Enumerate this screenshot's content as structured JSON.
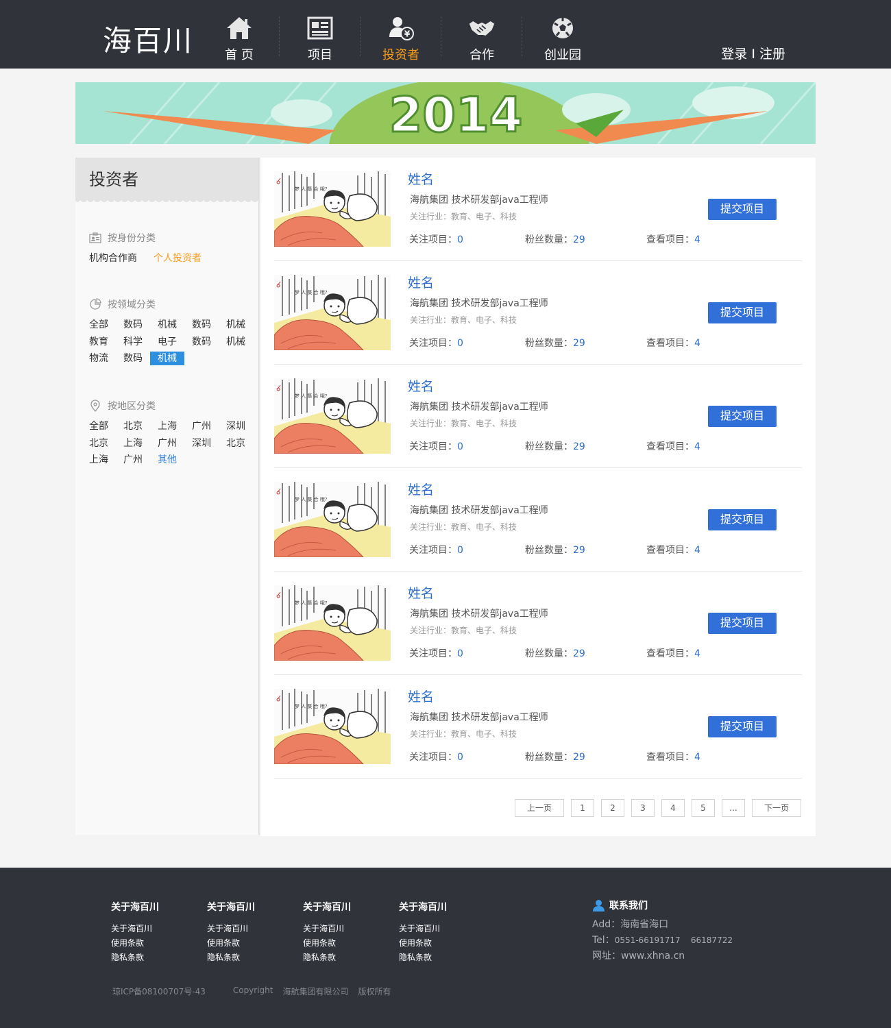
{
  "header": {
    "logo": "海百川",
    "nav": [
      {
        "label": "首 页",
        "icon": "home-icon"
      },
      {
        "label": "项目",
        "icon": "newspaper-icon"
      },
      {
        "label": "投资者",
        "icon": "investor-icon",
        "active": true
      },
      {
        "label": "合作",
        "icon": "handshake-icon"
      },
      {
        "label": "创业园",
        "icon": "football-icon"
      }
    ],
    "login": "登录",
    "divider": "I",
    "register": "注册"
  },
  "banner": {
    "text": "2014"
  },
  "sidebar": {
    "title": "投资者",
    "identity": {
      "heading": "按身份分类",
      "icon": "id-card-icon",
      "options": [
        "机构合作商",
        "个人投资者"
      ],
      "selected_index": 1
    },
    "field": {
      "heading": "按领域分类",
      "icon": "pie-chart-icon",
      "options": [
        "全部",
        "数码",
        "机械",
        "数码",
        "机械",
        "教育",
        "科学",
        "电子",
        "数码",
        "机械",
        "物流",
        "数码",
        "机械"
      ],
      "selected_index": 12
    },
    "region": {
      "heading": "按地区分类",
      "icon": "location-pin-icon",
      "options": [
        "全部",
        "北京",
        "上海",
        "广州",
        "深圳",
        "北京",
        "上海",
        "广州",
        "深圳",
        "北京",
        "上海",
        "广州",
        "其他"
      ],
      "selected_index": 12
    }
  },
  "investors": [
    {
      "name": "姓名",
      "org": "海航集团 技术研发部java工程师",
      "focus": "关注行业：教育、电子、科技",
      "follow_label": "关注项目：",
      "follow": "0",
      "fans_label": "粉丝数量：",
      "fans": "29",
      "view_label": "查看项目：",
      "views": "4",
      "button": "提交项目"
    },
    {
      "name": "姓名",
      "org": "海航集团 技术研发部java工程师",
      "focus": "关注行业：教育、电子、科技",
      "follow_label": "关注项目：",
      "follow": "0",
      "fans_label": "粉丝数量：",
      "fans": "29",
      "view_label": "查看项目：",
      "views": "4",
      "button": "提交项目"
    },
    {
      "name": "姓名",
      "org": "海航集团 技术研发部java工程师",
      "focus": "关注行业：教育、电子、科技",
      "follow_label": "关注项目：",
      "follow": "0",
      "fans_label": "粉丝数量：",
      "fans": "29",
      "view_label": "查看项目：",
      "views": "4",
      "button": "提交项目"
    },
    {
      "name": "姓名",
      "org": "海航集团 技术研发部java工程师",
      "focus": "关注行业：教育、电子、科技",
      "follow_label": "关注项目：",
      "follow": "0",
      "fans_label": "粉丝数量：",
      "fans": "29",
      "view_label": "查看项目：",
      "views": "4",
      "button": "提交项目"
    },
    {
      "name": "姓名",
      "org": "海航集团 技术研发部java工程师",
      "focus": "关注行业：教育、电子、科技",
      "follow_label": "关注项目：",
      "follow": "0",
      "fans_label": "粉丝数量：",
      "fans": "29",
      "view_label": "查看项目：",
      "views": "4",
      "button": "提交项目"
    },
    {
      "name": "姓名",
      "org": "海航集团 技术研发部java工程师",
      "focus": "关注行业：教育、电子、科技",
      "follow_label": "关注项目：",
      "follow": "0",
      "fans_label": "粉丝数量：",
      "fans": "29",
      "view_label": "查看项目：",
      "views": "4",
      "button": "提交项目"
    }
  ],
  "pagination": {
    "prev": "上一页",
    "pages": [
      "1",
      "2",
      "3",
      "4",
      "5",
      "..."
    ],
    "next": "下一页"
  },
  "footer": {
    "columns": [
      {
        "title": "关于海百川",
        "links": [
          "关于海百川",
          "使用条款",
          "隐私条款"
        ]
      },
      {
        "title": "关于海百川",
        "links": [
          "关于海百川",
          "使用条款",
          "隐私条款"
        ]
      },
      {
        "title": "关于海百川",
        "links": [
          "关于海百川",
          "使用条款",
          "隐私条款"
        ]
      },
      {
        "title": "关于海百川",
        "links": [
          "关于海百川",
          "使用条款",
          "隐私条款"
        ]
      }
    ],
    "contact": {
      "title": "联系我们",
      "address": "Add：海南省海口",
      "tel_label": "Tel：",
      "tel": "0551-66191717    66187722",
      "site_label": "网址：",
      "site": "www.xhna.cn"
    },
    "icp": "琼ICP备08100707号-43",
    "copyright": "Copyright",
    "company": "海航集团有限公司",
    "rights": "版权所有"
  },
  "colors": {
    "header_bg": "#31333b",
    "accent_orange": "#f89c1c",
    "link_blue": "#2d6fce",
    "button_blue": "#3270d9"
  }
}
